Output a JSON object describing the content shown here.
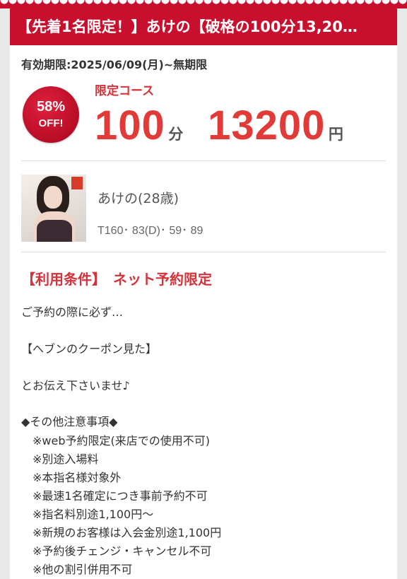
{
  "header": {
    "title": "【先着1名限定！】あけの【破格の100分13,20…"
  },
  "coupon": {
    "validity": "有効期限:2025/06/09(月)~無期限",
    "badge_percent": "58%",
    "badge_off": "OFF!",
    "course_label": "限定コース",
    "minutes": "100",
    "minutes_unit": "分",
    "price": "13200",
    "price_unit": "円"
  },
  "profile": {
    "name": "あけの(28歳)",
    "stats": "T160･ 83(D)･ 59･ 89",
    "photo_icon": "profile-photo"
  },
  "conditions": {
    "title": "【利用条件】　ネット予約限定",
    "intro": "ご予約の際に必ず…",
    "phrase": "【ヘブンのクーポン見た】",
    "closing": "とお伝え下さいませ♪",
    "notes_heading": "◆その他注意事項◆",
    "notes": [
      "※web予約限定(来店での使用不可)",
      "※別途入場料",
      "※本指名様対象外",
      "※最速1名確定につき事前予約不可",
      "※指名料別途1,100円～",
      "※新規のお客様は入会金別途1,100円",
      "※予約後チェンジ・キャンセル不可",
      "※他の割引併用不可"
    ]
  },
  "colors": {
    "brand_red": "#c8102e",
    "price_red": "#e23a36",
    "accent_red": "#d6323a"
  }
}
